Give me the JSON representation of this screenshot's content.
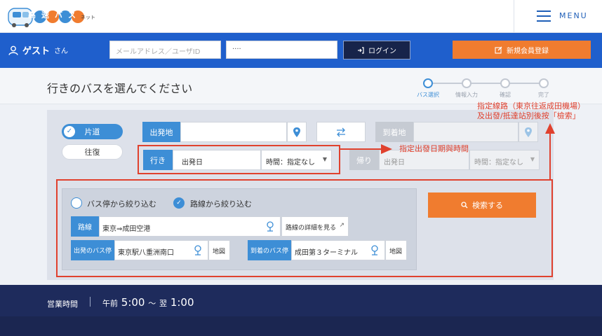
{
  "header": {
    "logo_text": "高速バス",
    "logo_suffix": "ネット",
    "menu_label": "MENU"
  },
  "login": {
    "guest_name": "ゲスト",
    "guest_suffix": "さん",
    "email_placeholder": "メールアドレス／ユーザID",
    "password_value": "····",
    "login_label": "ログイン",
    "register_label": "新規会員登録"
  },
  "page": {
    "title": "行きのバスを選んでください",
    "steps": [
      {
        "label": "バス選択",
        "active": true
      },
      {
        "label": "情報入力",
        "active": false
      },
      {
        "label": "確認",
        "active": false
      },
      {
        "label": "完了",
        "active": false
      }
    ]
  },
  "search": {
    "trip_types": {
      "oneway": "片道",
      "roundtrip": "往復"
    },
    "departure_label": "出発地",
    "arrival_label": "到着地",
    "outbound": {
      "tag": "行き",
      "date": "出発日",
      "time": "時間：指定なし"
    },
    "return": {
      "tag": "帰り",
      "date": "出発日",
      "time": "時間：指定なし"
    },
    "filter_by_stop": "バス停から絞り込む",
    "filter_by_route": "路線から絞り込む",
    "route_tag": "路線",
    "route_value": "東京⇒成田空港",
    "route_detail": "路線の詳細を見る",
    "dep_stop_tag": "出発のバス停",
    "dep_stop_value": "東京駅八重洲南口",
    "arr_stop_tag": "到着のバス停",
    "arr_stop_value": "成田第３ターミナル",
    "map_label": "地図",
    "search_button": "検索する"
  },
  "annotations": {
    "date_note": "指定出發日期與時間",
    "route_note_1": "指定線路（東京往返成田機場）",
    "route_note_2": "及出發/抵達站別後按「檢索」"
  },
  "footer": {
    "hours_label": "営業時間",
    "am": "午前",
    "open": "5:00",
    "tilde": "〜",
    "next_day": "翌",
    "close": "1:00"
  },
  "colors": {
    "brand_blue": "#1f5fcc",
    "accent_blue": "#3d8ed6",
    "orange": "#f07c2f",
    "annotation_red": "#e0412e",
    "footer_navy": "#1e2b5c"
  }
}
